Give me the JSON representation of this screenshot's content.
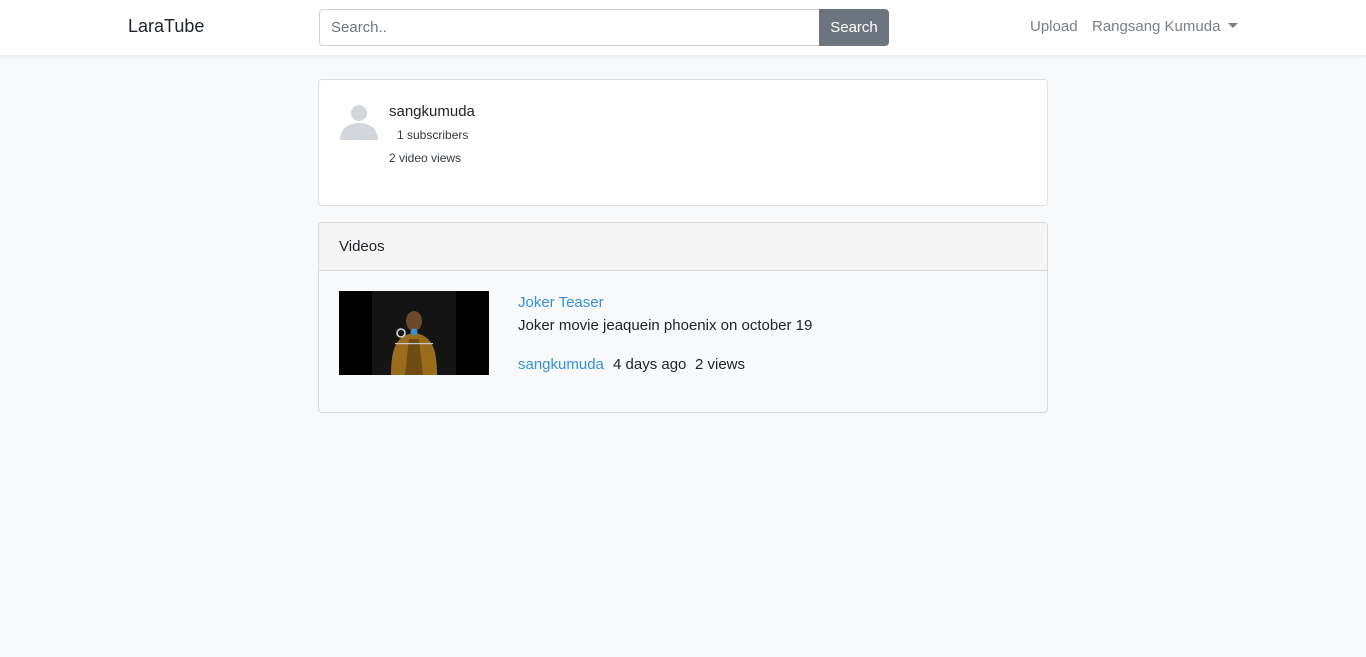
{
  "navbar": {
    "brand": "LaraTube",
    "search_placeholder": "Search..",
    "search_label": "Search",
    "upload_label": "Upload",
    "user_name": "Rangsang Kumuda"
  },
  "profile": {
    "channel_name": "sangkumuda",
    "subscribers": "1 subscribers",
    "video_views": "2 video views",
    "avatar_icon": "user-silhouette-icon"
  },
  "videos": {
    "header": "Videos",
    "items": [
      {
        "title": "Joker Teaser",
        "description": "Joker movie jeaquein phoenix on october 19",
        "channel": "sangkumuda",
        "time": "4 days ago",
        "views": "2 views"
      }
    ]
  },
  "colors": {
    "link": "#3490dc",
    "search_button": "#6c757d",
    "page_background": "#f8f9fa"
  }
}
